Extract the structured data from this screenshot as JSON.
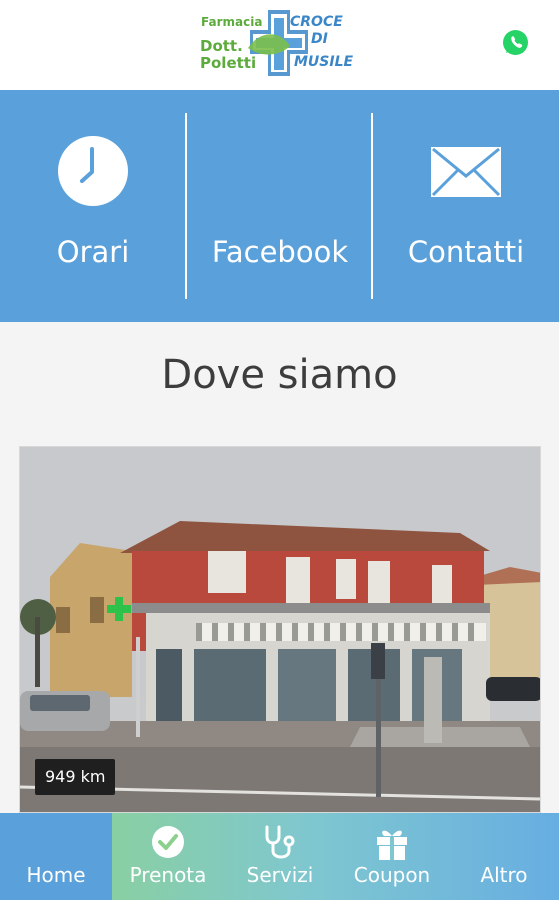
{
  "header": {
    "logo": {
      "line1": "Farmacia",
      "line2": "Dott.",
      "line3": "Poletti",
      "line4": "CROCE",
      "line5": "DI",
      "line6": "MUSILE"
    },
    "whatsapp_icon": "whatsapp-icon"
  },
  "actions": [
    {
      "label": "Orari",
      "icon": "clock-icon"
    },
    {
      "label": "Facebook",
      "icon": ""
    },
    {
      "label": "Contatti",
      "icon": "envelope-icon"
    }
  ],
  "section": {
    "title": "Dove siamo"
  },
  "map": {
    "distance": "949 km"
  },
  "nav": {
    "tabs": [
      {
        "label": "Home",
        "icon": "",
        "active": true
      },
      {
        "label": "Prenota",
        "icon": "check-circle-icon",
        "active": false
      },
      {
        "label": "Servizi",
        "icon": "stethoscope-icon",
        "active": false
      },
      {
        "label": "Coupon",
        "icon": "gift-icon",
        "active": false
      },
      {
        "label": "Altro",
        "icon": "",
        "active": false
      }
    ]
  },
  "colors": {
    "primary": "#5aa0da",
    "brand_green": "#5dab3c",
    "brand_blue": "#3a86c8",
    "whatsapp": "#25d366"
  }
}
